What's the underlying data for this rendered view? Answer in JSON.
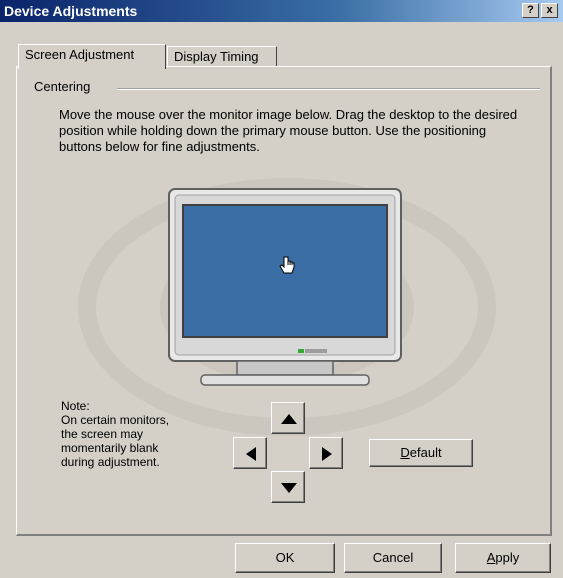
{
  "window": {
    "title": "Device Adjustments",
    "help_label": "?",
    "close_label": "x"
  },
  "tabs": [
    {
      "label": "Screen Adjustment",
      "active": true
    },
    {
      "label": "Display Timing",
      "active": false
    }
  ],
  "group": {
    "label": "Centering"
  },
  "instructions": "Move the mouse over the monitor image below. Drag the desktop to the desired position while holding down the primary mouse button. Use the positioning buttons below for fine adjustments.",
  "note": "Note:\nOn certain monitors, the screen may momentarily blank during adjustment.",
  "default_button": {
    "mnemonic": "D",
    "rest": "efault"
  },
  "footer": {
    "ok": "OK",
    "cancel": "Cancel",
    "apply_mnemonic": "A",
    "apply_rest": "pply"
  },
  "colors": {
    "titlebar": "#0a246a",
    "screen": "#3a6ea5",
    "dialog": "#d4d0c8"
  },
  "icons": [
    "up-arrow-icon",
    "left-arrow-icon",
    "right-arrow-icon",
    "down-arrow-icon",
    "hand-cursor-icon"
  ]
}
